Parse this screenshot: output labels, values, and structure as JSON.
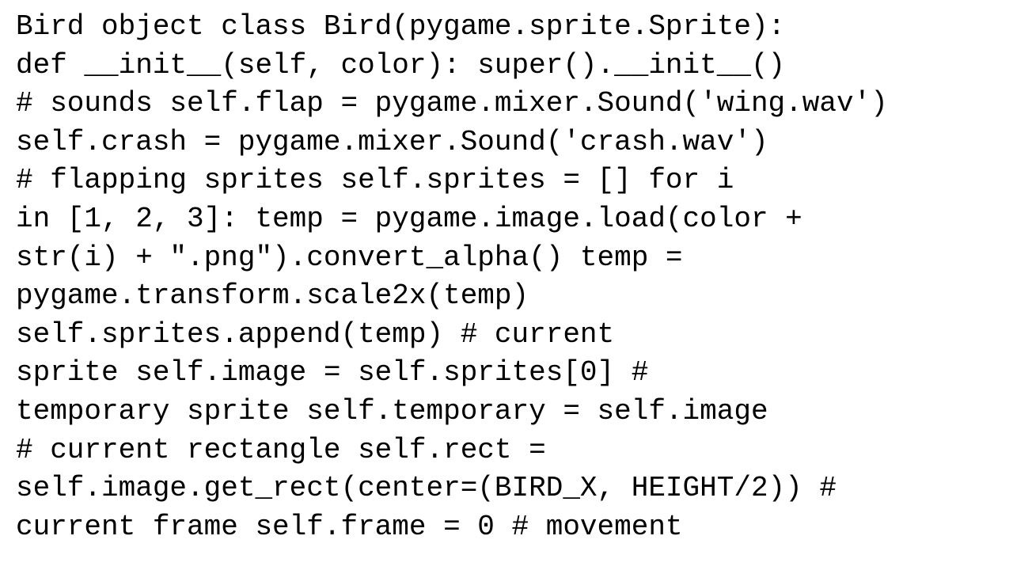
{
  "code": {
    "lines": [
      "    Bird object      class Bird(pygame.sprite.Sprite):",
      "        def __init__(self, color):        super().__init__()",
      "# sounds        self.flap = pygame.mixer.Sound('wing.wav')",
      "        self.crash = pygame.mixer.Sound('crash.wav')",
      "        # flapping sprites        self.sprites = []        for i",
      "    in [1, 2, 3]:            temp = pygame.image.load(color +",
      "        str(i) + \".png\").convert_alpha()            temp =",
      "                pygame.transform.scale2x(temp)",
      "        self.sprites.append(temp)                        # current",
      "            sprite        self.image = self.sprites[0]        #",
      "        temporary sprite        self.temporary = self.image",
      "                # current rectangle        self.rect =",
      "self.image.get_rect(center=(BIRD_X, HEIGHT/2))        #",
      "    current frame        self.frame = 0        # movement"
    ]
  }
}
